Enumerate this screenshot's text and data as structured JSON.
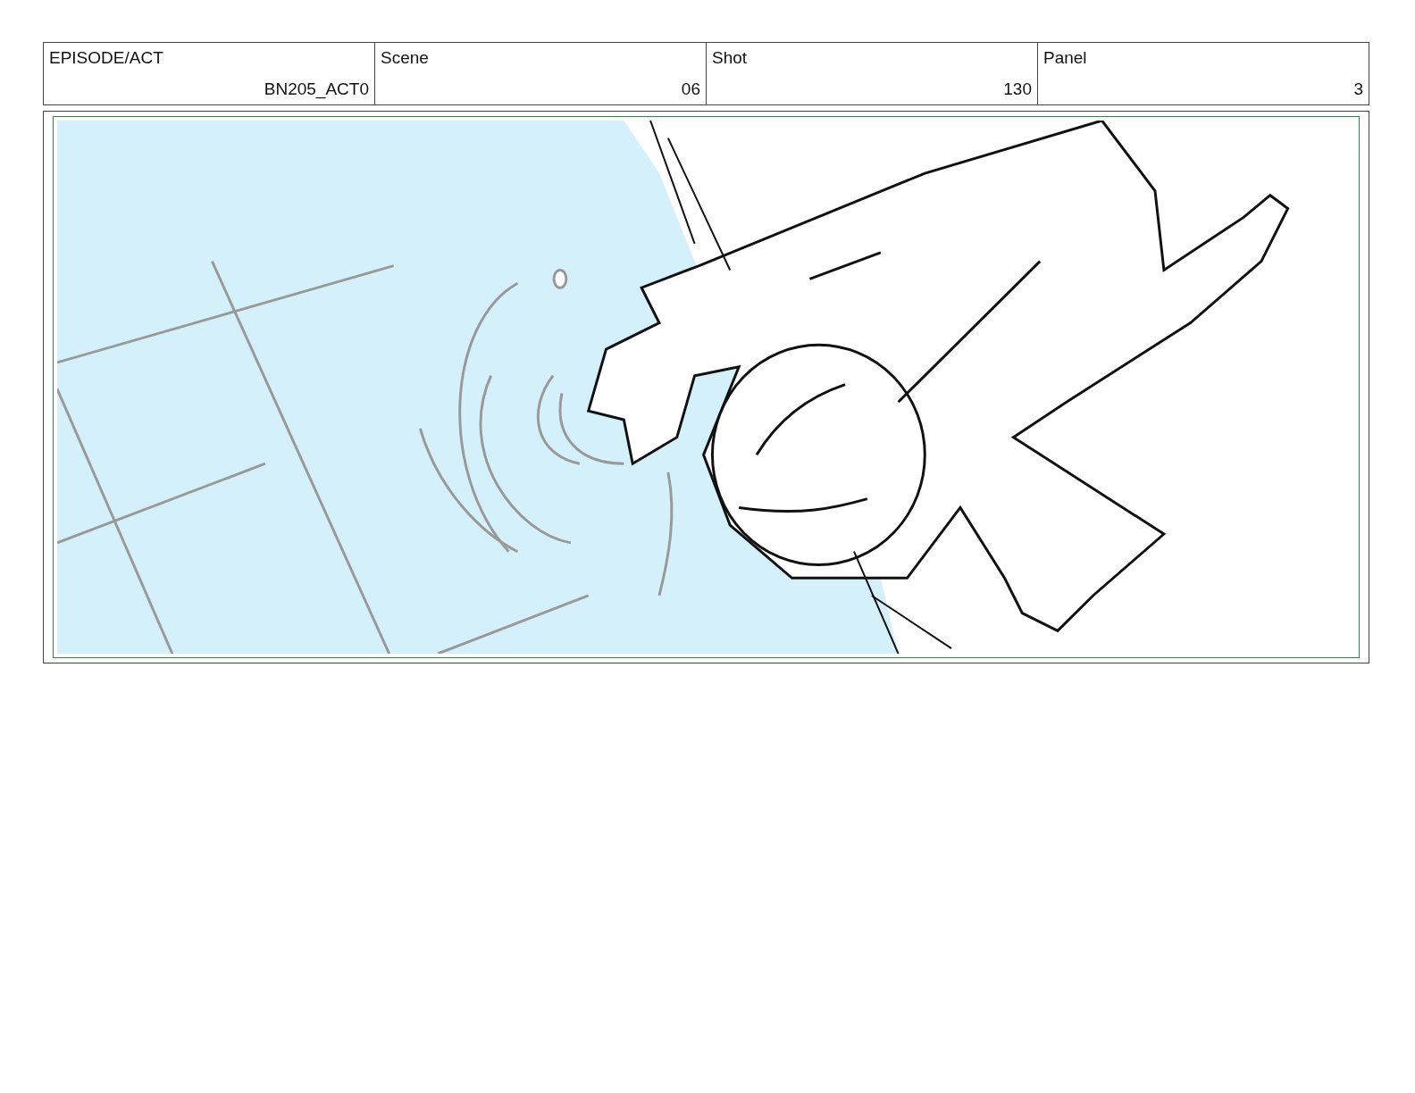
{
  "header": {
    "columns": [
      "EPISODE/ACT",
      "Scene",
      "Shot",
      "Panel"
    ],
    "rows": [
      [
        "BN205_ACT0",
        "06",
        "130",
        "3"
      ]
    ]
  }
}
